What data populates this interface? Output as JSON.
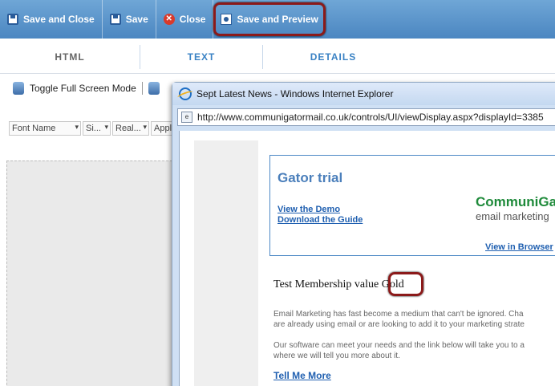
{
  "toolbar": {
    "save_close": "Save and Close",
    "save": "Save",
    "close": "Close",
    "save_preview": "Save and Preview"
  },
  "tabs": [
    {
      "label": "HTML"
    },
    {
      "label": "TEXT"
    },
    {
      "label": "DETAILS"
    }
  ],
  "editor": {
    "toggle_fullscreen": "Toggle Full Screen Mode",
    "font_name": "Font Name",
    "font_size": "Si...",
    "paragraph": "Real...",
    "apply": "Apply"
  },
  "browser": {
    "title": "Sept Latest News - Windows Internet Explorer",
    "url": "http://www.communigatormail.co.uk/controls/UI/viewDisplay.aspx?displayId=3385",
    "email": {
      "heading": "Gator trial",
      "link_demo": "View the Demo",
      "link_guide": "Download the Guide",
      "brand": "CommuniGa",
      "brand_sub": "email marketing",
      "view_browser": "View in Browser",
      "membership_label": "Test Membership value ",
      "membership_value": "Gold",
      "para1_line1": "Email Marketing has fast become a medium that can't be ignored. Cha",
      "para1_line2": "are already using email or are looking to add it to your marketing strate",
      "para2_line1": "Our software can meet your needs and the link below will take you to a",
      "para2_line2": "where we will tell you more about it.",
      "tell_me": "Tell Me More"
    }
  },
  "colors": {
    "toolbar_bg": "#4b86c1",
    "tab_active": "#666666",
    "tab_link": "#3a82c4",
    "highlight": "#8b1a1a",
    "brand_green": "#1e8a3a"
  }
}
